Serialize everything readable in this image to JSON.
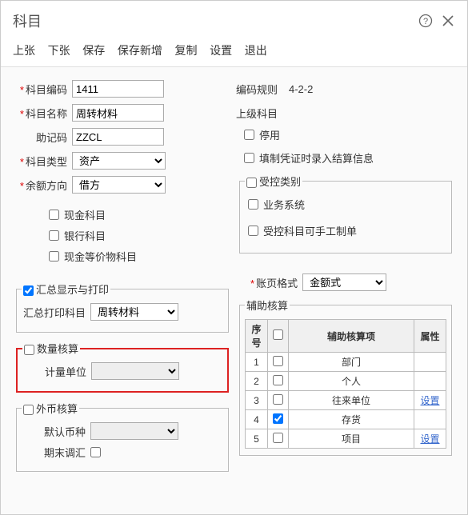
{
  "header": {
    "title": "科目"
  },
  "menu": {
    "prev": "上张",
    "next": "下张",
    "save": "保存",
    "save_new": "保存新增",
    "copy": "复制",
    "settings": "设置",
    "exit": "退出"
  },
  "left": {
    "code_label": "科目编码",
    "code_value": "1411",
    "name_label": "科目名称",
    "name_value": "周转材料",
    "mnemonic_label": "助记码",
    "mnemonic_value": "ZZCL",
    "type_label": "科目类型",
    "type_value": "资产",
    "balance_label": "余额方向",
    "balance_value": "借方",
    "cash_label": "现金科目",
    "bank_label": "银行科目",
    "cash_eq_label": "现金等价物科目"
  },
  "right": {
    "rule_label": "编码规则",
    "rule_value": "4-2-2",
    "parent_label": "上级科目",
    "disabled_label": "停用",
    "recalc_label": "填制凭证时录入结算信息"
  },
  "controlled": {
    "legend": "受控类别",
    "biz_label": "业务系统",
    "manual_label": "受控科目可手工制单"
  },
  "summary": {
    "legend": "汇总显示与打印",
    "print_label": "汇总打印科目",
    "print_value": "周转材料"
  },
  "quantity": {
    "legend": "数量核算",
    "unit_label": "计量单位"
  },
  "currency": {
    "legend": "外币核算",
    "default_label": "默认币种",
    "adjust_label": "期末调汇"
  },
  "format": {
    "label": "账页格式",
    "value": "金额式"
  },
  "aux": {
    "legend": "辅助核算",
    "h_seq": "序号",
    "h_item": "辅助核算项",
    "h_attr": "属性",
    "rows": [
      {
        "seq": "1",
        "checked": false,
        "item": "部门",
        "attr": ""
      },
      {
        "seq": "2",
        "checked": false,
        "item": "个人",
        "attr": ""
      },
      {
        "seq": "3",
        "checked": false,
        "item": "往来单位",
        "attr": "设置"
      },
      {
        "seq": "4",
        "checked": true,
        "item": "存货",
        "attr": ""
      },
      {
        "seq": "5",
        "checked": false,
        "item": "项目",
        "attr": "设置"
      }
    ]
  }
}
